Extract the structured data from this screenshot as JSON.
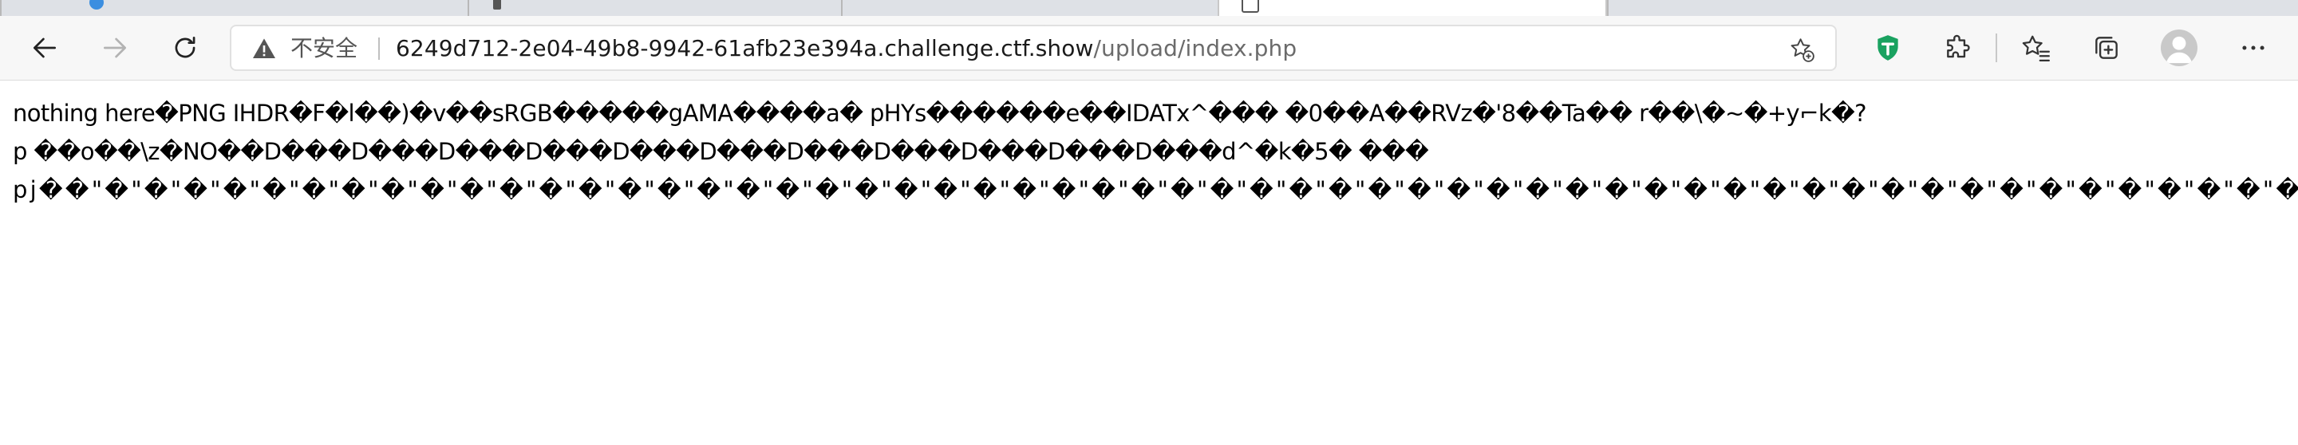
{
  "browser": {
    "security_label": "不安全",
    "url_host": "6249d712-2e04-49b8-9942-61afb23e394a.challenge.ctf.show",
    "url_path": "/upload/index.php",
    "icons": {
      "back": "arrow-left-icon",
      "forward": "arrow-right-icon",
      "reload": "reload-icon",
      "warning": "warning-triangle-icon",
      "favorite": "star-plus-icon",
      "extension_shield": "green-shield-icon",
      "extensions": "puzzle-icon",
      "favorites": "favorites-star-list-icon",
      "collections": "collections-icon",
      "profile": "profile-avatar-icon",
      "menu": "more-dots-icon"
    },
    "colors": {
      "tab_bar": "#dee1e6",
      "toolbar": "#f7f7f7",
      "shield": "#1aa260",
      "tab_icon_blue": "#3b8ee0"
    }
  },
  "page": {
    "lines": [
      "nothing here�PNG  IHDR�F�l��)�v��sRGB�����gAMA����a� pHYs������e��IDATx^��� �0��A��RVz�'8��Ta�� r��\\�~�+y⌐k�?",
      "p ��o��\\z�NO��D���D���D���D���D���D���D���D���D���D���D���d^�k�5� ���",
      "pj��\"�\"�\"�\"�\"�\"�\"�\"�\"�\"�\"�\"�\"�\"�\"�\"�\"�\"�\"�\"�\"�\"�\"�\"�\"�\"�\"�\"�\"�\"�\"�\"�\"�\"�\"�\"�\"�\"�\"�\"�\"�\"�\"�\"�\"�\"�\"�\"�\"�\"�\"�\"�\"�\"�\"�\"�\"�\"�\"�\"�\"�\"�\"�\""
    ]
  }
}
